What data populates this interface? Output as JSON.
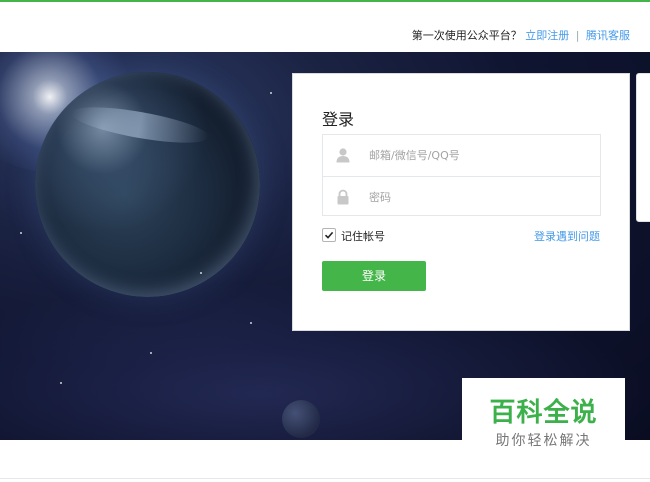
{
  "header": {
    "prompt": "第一次使用公众平台？",
    "register_link": "立即注册",
    "separator": "|",
    "support_link": "腾讯客服"
  },
  "login": {
    "title": "登录",
    "account_placeholder": "邮箱/微信号/QQ号",
    "password_placeholder": "密码",
    "remember_label": "记住帐号",
    "remember_checked": true,
    "help_link": "登录遇到问题",
    "submit_label": "登录"
  },
  "watermark": {
    "main": "百科全说",
    "sub": "助你轻松解决"
  },
  "colors": {
    "brand_green": "#44b549",
    "link_blue": "#459ae9"
  },
  "icons": {
    "account": "user-icon",
    "password": "lock-icon",
    "checkbox": "checkmark-icon"
  }
}
